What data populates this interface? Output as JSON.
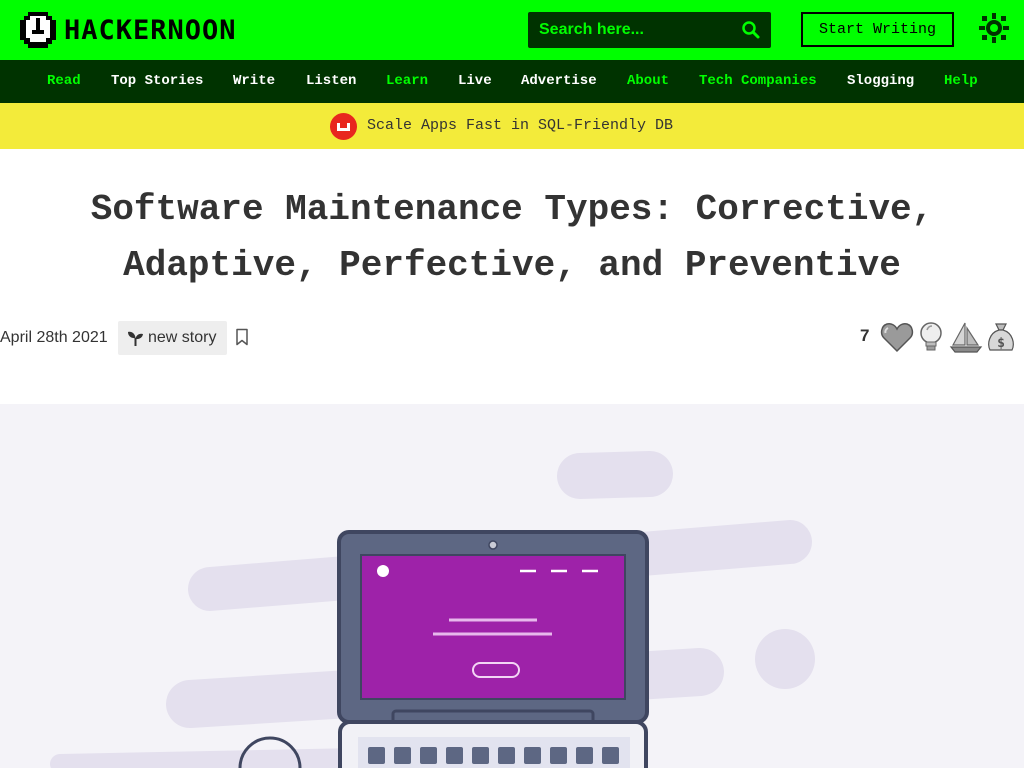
{
  "header": {
    "logo_text": "HACKERNOON",
    "search_placeholder": "Search here...",
    "start_writing": "Start Writing"
  },
  "nav": {
    "items": [
      {
        "label": "Read"
      },
      {
        "label": "Top Stories"
      },
      {
        "label": "Write"
      },
      {
        "label": "Listen"
      },
      {
        "label": "Learn"
      },
      {
        "label": "Live"
      },
      {
        "label": "Advertise"
      },
      {
        "label": "About"
      },
      {
        "label": "Tech Companies"
      },
      {
        "label": "Slogging"
      },
      {
        "label": "Help"
      }
    ]
  },
  "banner": {
    "text": "Scale Apps Fast in SQL-Friendly DB"
  },
  "article": {
    "title_line1": "Software Maintenance Types: Corrective,",
    "title_line2": "Adaptive, Perfective, and Preventive",
    "date": "April 28th 2021",
    "tag": "new story",
    "reaction_count": "7"
  },
  "icons": {
    "theme": "sun-icon",
    "search": "search-icon",
    "bookmark": "bookmark-icon",
    "tag": "sprout-icon",
    "reactions": [
      "heart-icon",
      "lightbulb-icon",
      "sailboat-icon",
      "money-bag-icon"
    ]
  },
  "colors": {
    "brand_green": "#00ff00",
    "nav_dark": "#003300",
    "banner_yellow": "#f3eb3a",
    "text_dark": "#333333",
    "hero_bg": "#f4f3f8",
    "screen_purple": "#9e22a9"
  }
}
